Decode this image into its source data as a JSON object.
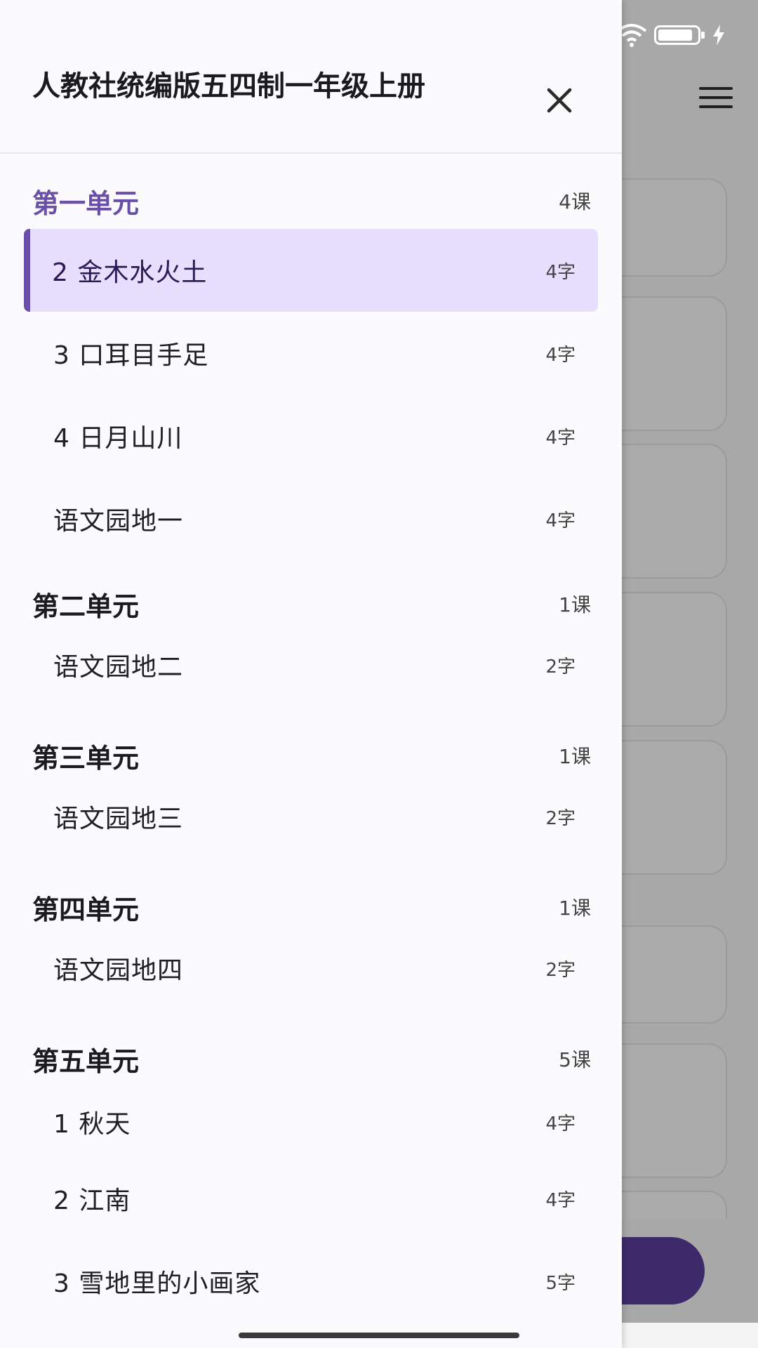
{
  "drawer": {
    "title": "人教社统编版五四制一年级上册",
    "close_icon": "close-icon"
  },
  "units": [
    {
      "title": "第一单元",
      "count": "4课",
      "lessons": [
        {
          "name": "2 金木水火土",
          "count": "4字",
          "selected": true
        },
        {
          "name": "3 口耳目手足",
          "count": "4字"
        },
        {
          "name": "4 日月山川",
          "count": "4字"
        },
        {
          "name": "语文园地一",
          "count": "4字"
        }
      ]
    },
    {
      "title": "第二单元",
      "count": "1课",
      "lessons": [
        {
          "name": "语文园地二",
          "count": "2字"
        }
      ]
    },
    {
      "title": "第三单元",
      "count": "1课",
      "lessons": [
        {
          "name": "语文园地三",
          "count": "2字"
        }
      ]
    },
    {
      "title": "第四单元",
      "count": "1课",
      "lessons": [
        {
          "name": "语文园地四",
          "count": "2字"
        }
      ]
    },
    {
      "title": "第五单元",
      "count": "5课",
      "lessons": [
        {
          "name": "1 秋天",
          "count": "4字"
        },
        {
          "name": "2 江南",
          "count": "4字"
        },
        {
          "name": "3 雪地里的小画家",
          "count": "5字"
        }
      ]
    }
  ],
  "background": {
    "menu_icon": "hamburger-menu-icon",
    "status_icons": [
      "wifi-icon",
      "battery-icon",
      "charging-icon"
    ],
    "accent_color": "#6a4fa8",
    "selected_bg_color": "#e7dffd",
    "fab_color": "#3e2a6b"
  }
}
